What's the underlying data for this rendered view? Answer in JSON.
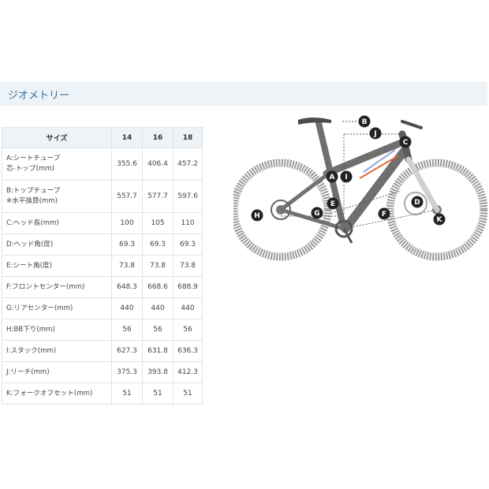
{
  "section": {
    "title": "ジオメトリー"
  },
  "table": {
    "headers": [
      "サイズ",
      "14",
      "16",
      "18"
    ],
    "rows": [
      {
        "label": [
          "A:シートチューブ",
          "芯-トップ(mm)"
        ],
        "values": [
          "355.6",
          "406.4",
          "457.2"
        ]
      },
      {
        "label": [
          "B:トップチューブ",
          "※水平換算(mm)"
        ],
        "values": [
          "557.7",
          "577.7",
          "597.6"
        ]
      },
      {
        "label": [
          "C:ヘッド長(mm)"
        ],
        "values": [
          "100",
          "105",
          "110"
        ]
      },
      {
        "label": [
          "D:ヘッド角(度)"
        ],
        "values": [
          "69.3",
          "69.3",
          "69.3"
        ]
      },
      {
        "label": [
          "E:シート角(度)"
        ],
        "values": [
          "73.8",
          "73.8",
          "73.8"
        ]
      },
      {
        "label": [
          "F:フロントセンター(mm)"
        ],
        "values": [
          "648.3",
          "668.6",
          "688.9"
        ]
      },
      {
        "label": [
          "G:リアセンター(mm)"
        ],
        "values": [
          "440",
          "440",
          "440"
        ]
      },
      {
        "label": [
          "H:BB下り(mm)"
        ],
        "values": [
          "56",
          "56",
          "56"
        ]
      },
      {
        "label": [
          "I:スタック(mm)"
        ],
        "values": [
          "627.3",
          "631.8",
          "636.3"
        ]
      },
      {
        "label": [
          "J:リーチ(mm)"
        ],
        "values": [
          "375.3",
          "393.8",
          "412.3"
        ]
      },
      {
        "label": [
          "K:フォークオフセット(mm)"
        ],
        "values": [
          "51",
          "51",
          "51"
        ]
      }
    ]
  },
  "diagram": {
    "markers": [
      "A",
      "B",
      "C",
      "D",
      "E",
      "F",
      "G",
      "H",
      "I",
      "J",
      "K"
    ],
    "colors": {
      "frame": "#6f6f6f",
      "tire": "#8a8a8a",
      "accent": "#e06a3a",
      "marker": "#222222"
    }
  }
}
